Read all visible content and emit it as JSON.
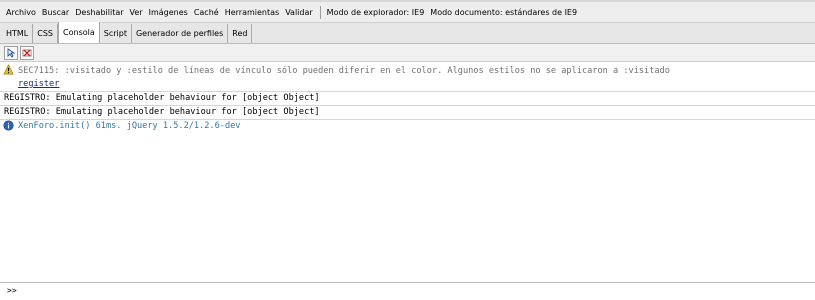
{
  "menubar": {
    "items": [
      "Archivo",
      "Buscar",
      "Deshabilitar",
      "Ver",
      "Imágenes",
      "Caché",
      "Herramientas",
      "Validar"
    ],
    "browser_mode": "Modo de explorador: IE9",
    "document_mode": "Modo documento:  estándares de IE9"
  },
  "tabs": [
    "HTML",
    "CSS",
    "Consola",
    "Script",
    "Generador de perfiles",
    "Red"
  ],
  "active_tab": "Consola",
  "toolbar": {
    "buttons": [
      {
        "name": "select-element-icon"
      },
      {
        "name": "clear-console-icon"
      }
    ]
  },
  "console": {
    "warning": {
      "icon": "warning-icon",
      "text": "SEC7115: :visitado y :estilo de líneas de vínculo sólo pueden diferir en el color. Algunos estilos no se aplicaron a :visitado",
      "link": "register"
    },
    "logs": [
      "REGISTRO: Emulating placeholder behaviour for [object Object]",
      "REGISTRO: Emulating placeholder behaviour for [object Object]"
    ],
    "info": {
      "icon": "info-icon",
      "text": "XenForo.init() 61ms. jQuery 1.5.2/1.2.6-dev"
    }
  },
  "command_line": {
    "prompt": ">>",
    "value": ""
  }
}
